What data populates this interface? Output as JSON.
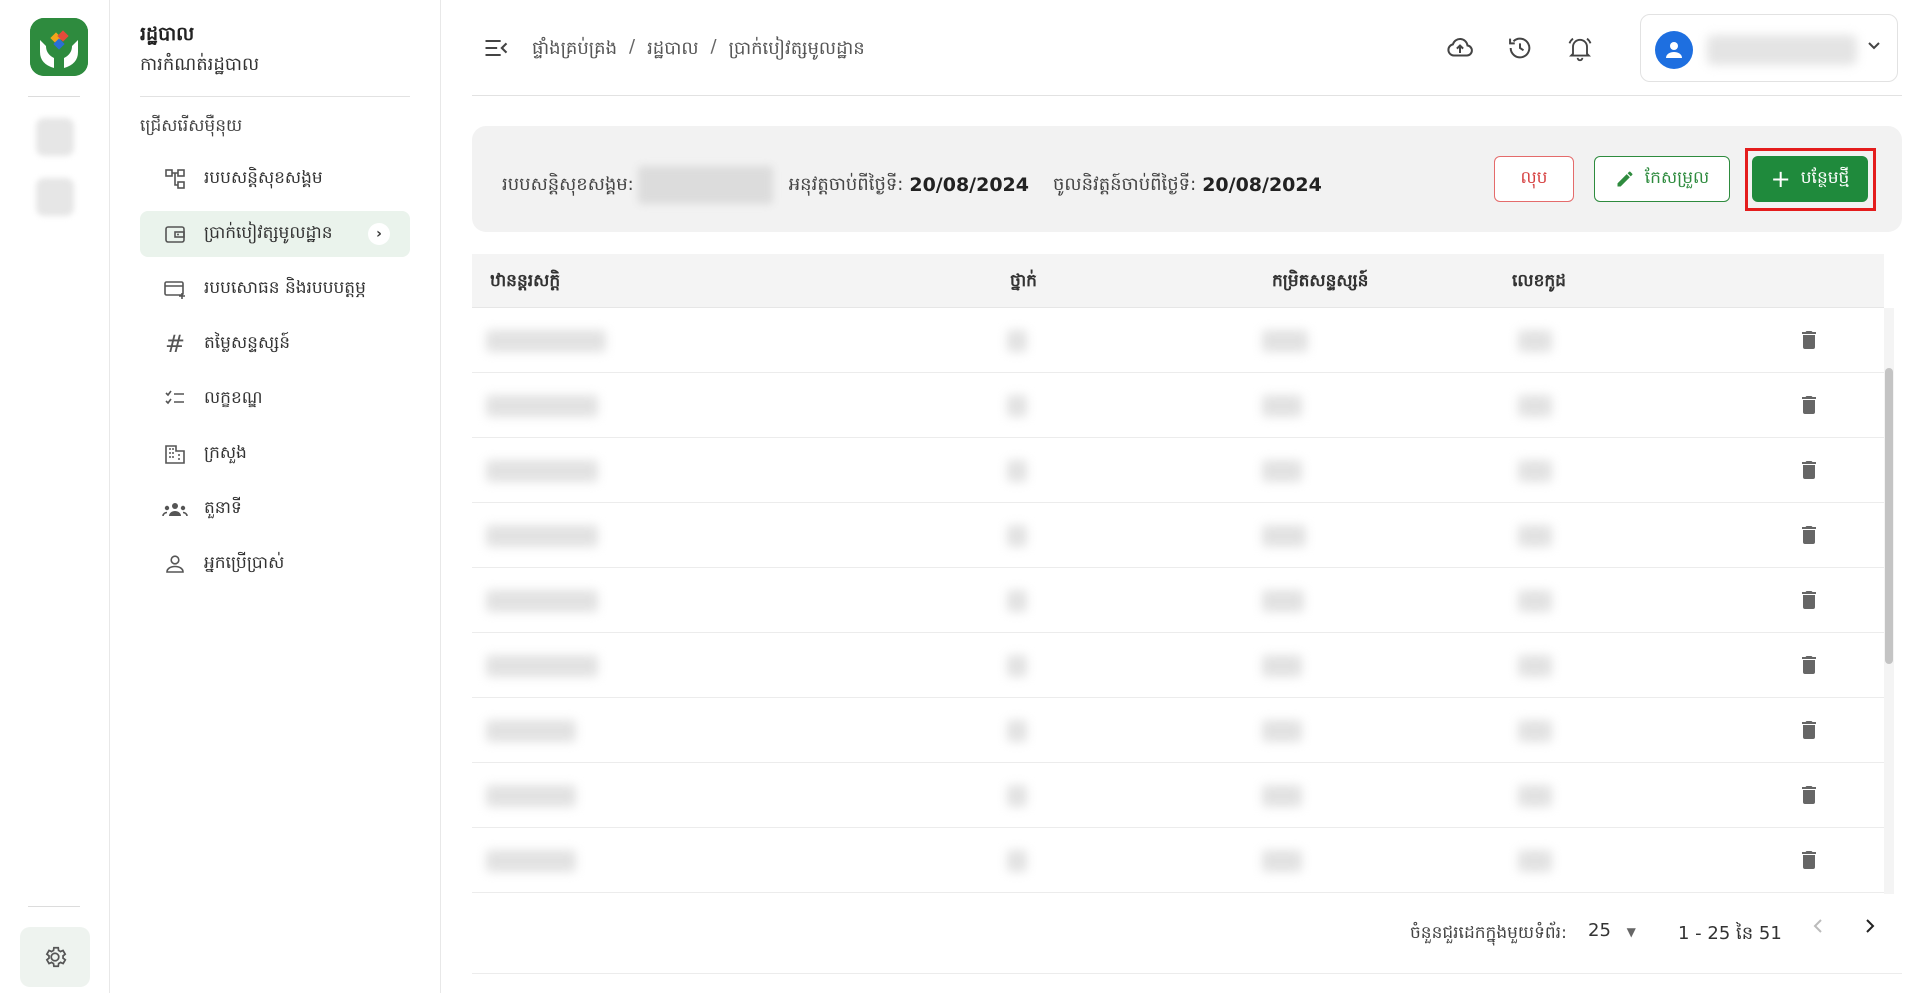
{
  "app": {
    "section_title": "រដ្ឋបាល",
    "section_subtitle": "ការកំណត់រដ្ឋបាល"
  },
  "sidebar": {
    "section_label": "ជ្រើសរើសម៉ឺនុយ",
    "items": [
      {
        "label": "របបសន្តិសុខសង្គម",
        "icon": "hierarchy-icon"
      },
      {
        "label": "ប្រាក់បៀវត្សមូលដ្ឋាន",
        "icon": "wallet-icon",
        "active": true
      },
      {
        "label": "របបសោធន និងរបបបត្តម្ភ",
        "icon": "card-add-icon"
      },
      {
        "label": "តម្លៃសន្ទស្សន៍",
        "icon": "hash-icon"
      },
      {
        "label": "លក្ខខណ្ឌ",
        "icon": "checklist-icon"
      },
      {
        "label": "ក្រសួង",
        "icon": "building-icon"
      },
      {
        "label": "តួនាទី",
        "icon": "group-icon"
      },
      {
        "label": "អ្នកប្រើប្រាស់",
        "icon": "person-icon"
      }
    ]
  },
  "breadcrumb": [
    "ផ្ទាំងគ្រប់គ្រង",
    "រដ្ឋបាល",
    "ប្រាក់បៀវត្សមូលដ្ឋាន"
  ],
  "info": {
    "scheme_label": "របបសន្តិសុខសង្គម:",
    "effective_label": "អនុវត្តចាប់ពីថ្ងៃទី:",
    "effective_date": "20/08/2024",
    "enforce_label": "ចូលនិវត្តន៍ចាប់ពីថ្ងៃទី:",
    "enforce_date": "20/08/2024"
  },
  "buttons": {
    "delete": "លុប",
    "edit": "កែសម្រួល",
    "add": "បន្ថែមថ្មី"
  },
  "table": {
    "columns": [
      "ឋានន្តរសក្តិ",
      "ថ្នាក់",
      "កម្រិតសន្ទស្សន៍",
      "លេខកូដ"
    ]
  },
  "pagination": {
    "rows_per_page_label": "ចំនួនជួរដេកក្នុងមួយទំព័រ:",
    "rows_per_page": "25",
    "range": "1 - 25 នៃ 51"
  },
  "colors": {
    "primary_green": "#1f8a3c",
    "danger_red": "#d64040",
    "avatar_blue": "#1e6fe0",
    "highlight_red": "#e41d1d"
  }
}
